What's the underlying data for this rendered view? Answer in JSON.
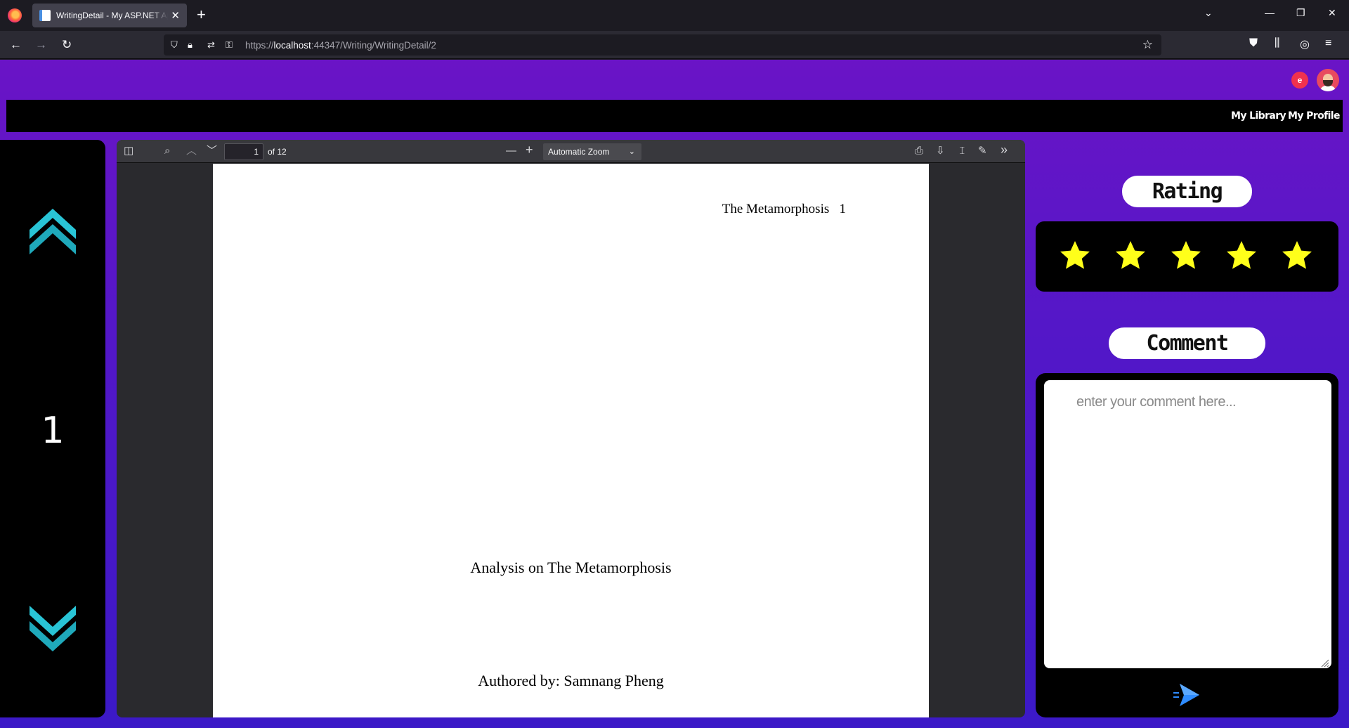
{
  "browser": {
    "tab_title": "WritingDetail - My ASP.NET App",
    "url_prefix": "https://",
    "url_host": "localhost",
    "url_path": ":44347/Writing/WritingDetail/2"
  },
  "site_nav": {
    "my_library": "My Library",
    "my_profile": "My Profile"
  },
  "reader": {
    "current_page": "1"
  },
  "pdf_viewer": {
    "page_input": "1",
    "page_count": "of 12",
    "zoom": "Automatic Zoom",
    "running_head": "The Metamorphosis   1",
    "title": "Analysis on The Metamorphosis",
    "author_line": "Authored by: Samnang Pheng"
  },
  "rating": {
    "label": "Rating",
    "value": 5,
    "max": 5,
    "star_color": "#ffff1a"
  },
  "comment": {
    "label": "Comment",
    "placeholder": "enter your comment here..."
  },
  "colors": {
    "page_gradient_top": "#6a14c6",
    "page_gradient_bottom": "#3b19c7",
    "chevron_teal": "#29c4d6",
    "send_blue": "#2f8cff"
  }
}
